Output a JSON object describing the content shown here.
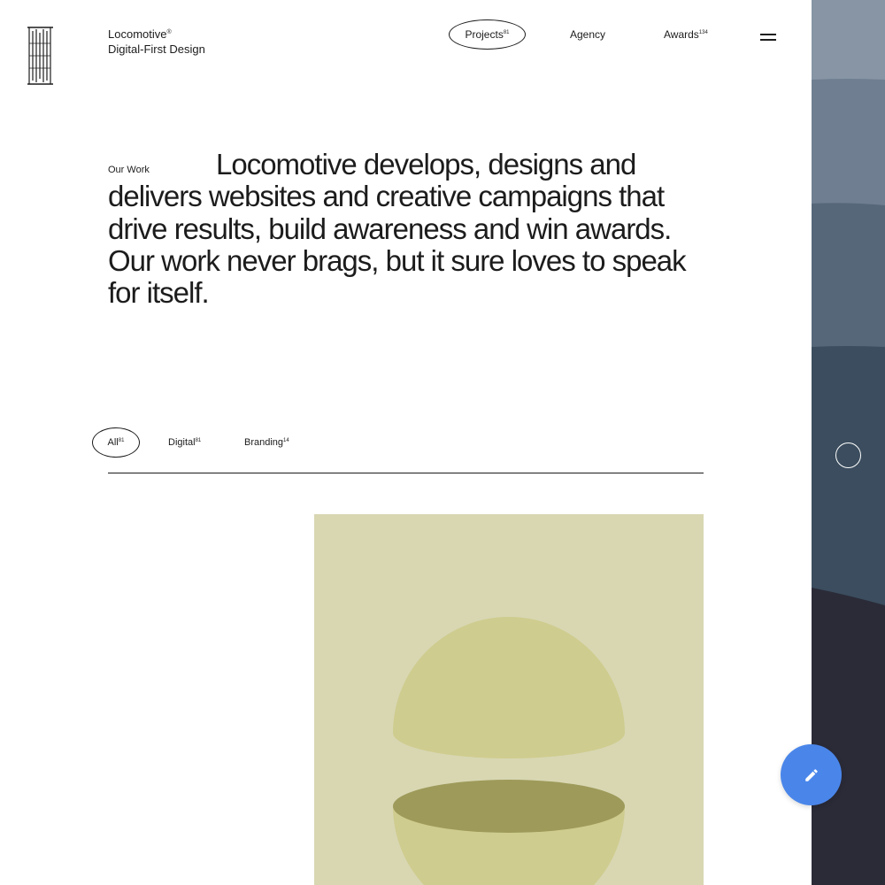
{
  "brand": {
    "name": "Locomotive",
    "registered_mark": "®",
    "tagline": "Digital-First Design"
  },
  "nav": {
    "items": [
      {
        "label": "Projects",
        "count": "81",
        "active": true
      },
      {
        "label": "Agency",
        "count": "",
        "active": false
      },
      {
        "label": "Awards",
        "count": "134",
        "active": false
      }
    ],
    "menu_icon": "hamburger-icon"
  },
  "intro": {
    "label": "Our Work",
    "text": "Locomotive develops, designs and delivers websites and creative campaigns that drive results, build awareness and win awards. Our work never brags, but it sure loves to speak for itself."
  },
  "filters": {
    "items": [
      {
        "label": "All",
        "count": "81",
        "active": true
      },
      {
        "label": "Digital",
        "count": "81",
        "active": false
      },
      {
        "label": "Branding",
        "count": "14",
        "active": false
      }
    ]
  },
  "fab": {
    "icon": "pencil-icon",
    "color": "#4a86ea"
  },
  "colors": {
    "background": "#ffffff",
    "text": "#1c1c1c",
    "card_background": "#d8d7b2",
    "sphere_light": "#cfcc8f",
    "sphere_dark": "#9e9a5a",
    "side_top": "#8795a5",
    "side_mid": "#3b4d5e",
    "side_bottom": "#2b2b38"
  }
}
